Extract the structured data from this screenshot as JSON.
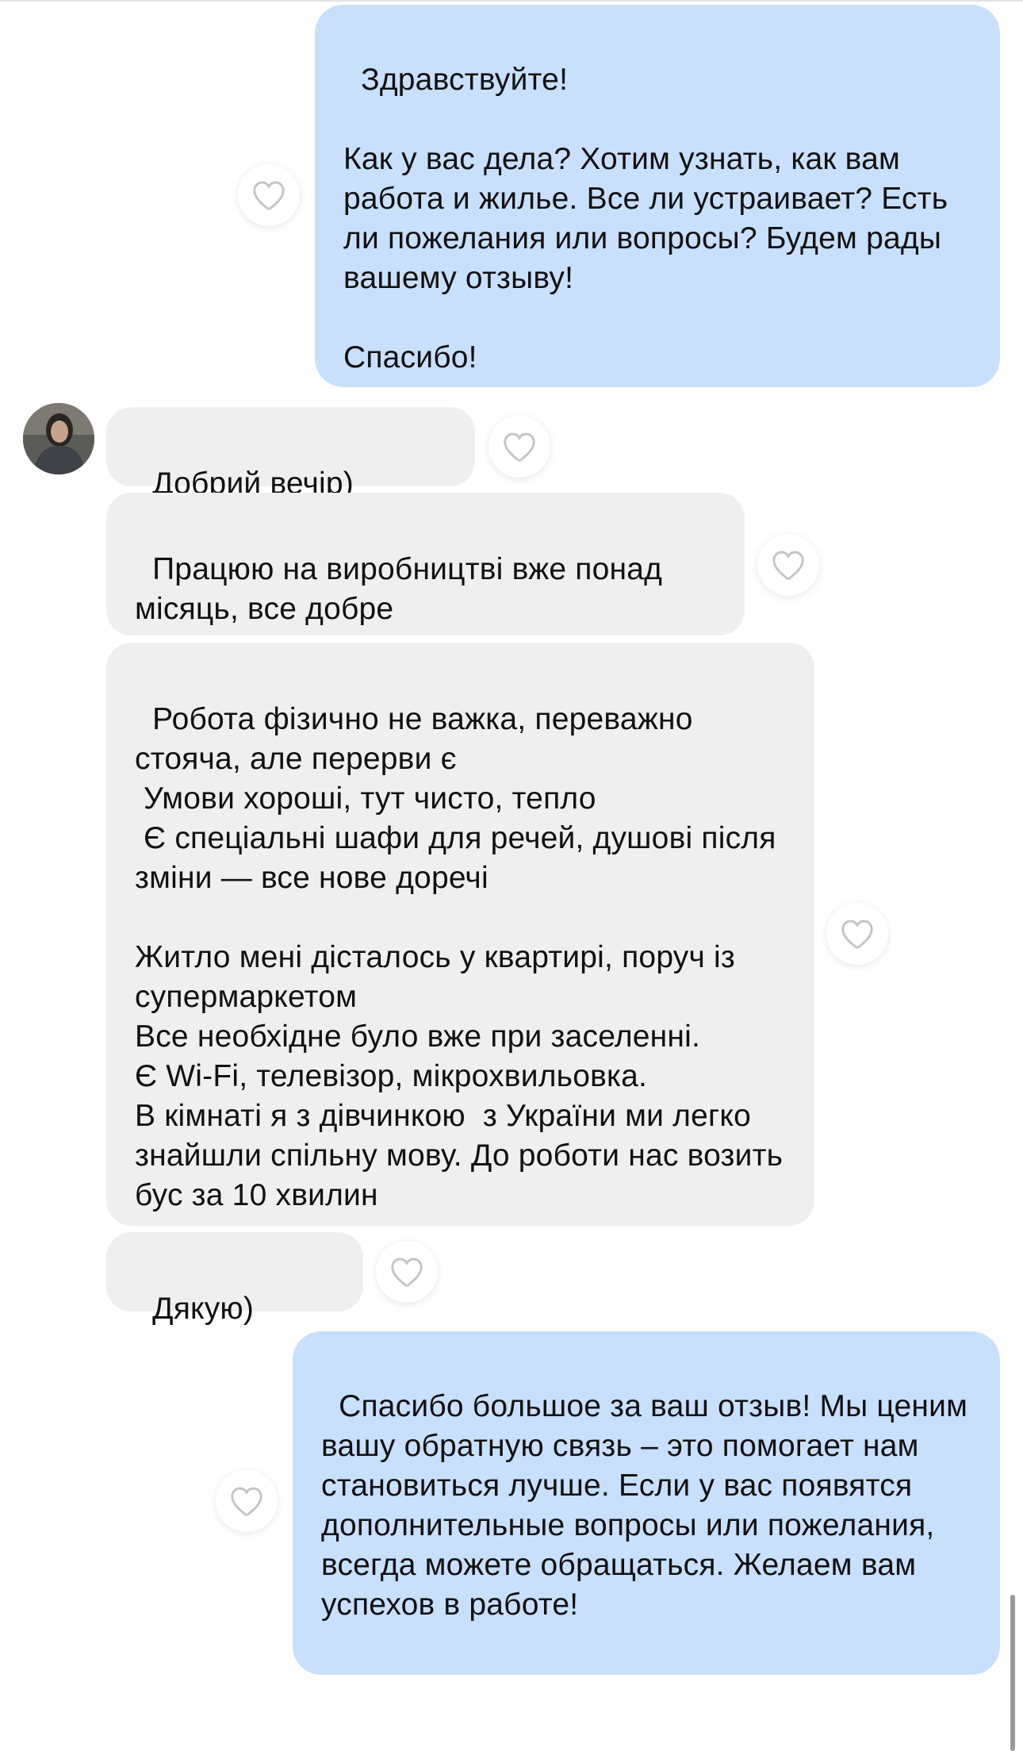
{
  "messages": [
    {
      "id": "m1",
      "sender": "me",
      "text": "Здравствуйте!\n\nКак у вас дела? Хотим узнать, как вам работа и жилье. Все ли устраивает? Есть ли пожелания или вопросы? Будем рады вашему отзыву!\n\nСпасибо!"
    },
    {
      "id": "m2",
      "sender": "contact",
      "text": "Добрий вечір)"
    },
    {
      "id": "m3",
      "sender": "contact",
      "text": "Працюю на виробництві вже понад місяць, все добре"
    },
    {
      "id": "m4",
      "sender": "contact",
      "text": "Робота фізично не важка, переважно стояча, але перерви є\n Умови хороші, тут чисто, тепло\n Є спеціальні шафи для речей, душові після зміни — все нове доречі\n\nЖитло мені дісталось у квартирі, поруч із супермаркетом\nВсе необхідне було вже при заселенні.\nЄ Wi-Fi, телевізор, мікрохвильовка.\nВ кімнаті я з дівчинкою  з України ми легко знайшли спільну мову. До роботи нас возить бус за 10 хвилин"
    },
    {
      "id": "m5",
      "sender": "contact",
      "text": "Дякую)"
    },
    {
      "id": "m6",
      "sender": "me",
      "text": "Спасибо большое за ваш отзыв! Мы ценим вашу обратную связь – это помогает нам становиться лучше. Если у вас появятся дополнительные вопросы или пожелания, всегда можете обращаться. Желаем вам успехов в работе!"
    }
  ],
  "icons": {
    "like": "heart-outline-icon",
    "avatar": "contact-avatar"
  },
  "colors": {
    "outgoing_bubble": "#c8e0fb",
    "incoming_bubble": "#efefef",
    "like_icon": "#c4c4c4"
  }
}
